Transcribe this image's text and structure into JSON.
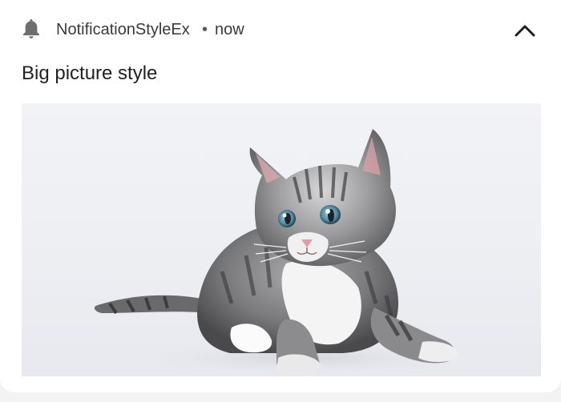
{
  "notification": {
    "app_name": "NotificationStyleEx",
    "separator": "•",
    "time": "now",
    "title": "Big picture style",
    "icons": {
      "app": "bell-icon",
      "collapse": "chevron-up-icon"
    },
    "picture": {
      "subject": "kitten-photo"
    }
  }
}
